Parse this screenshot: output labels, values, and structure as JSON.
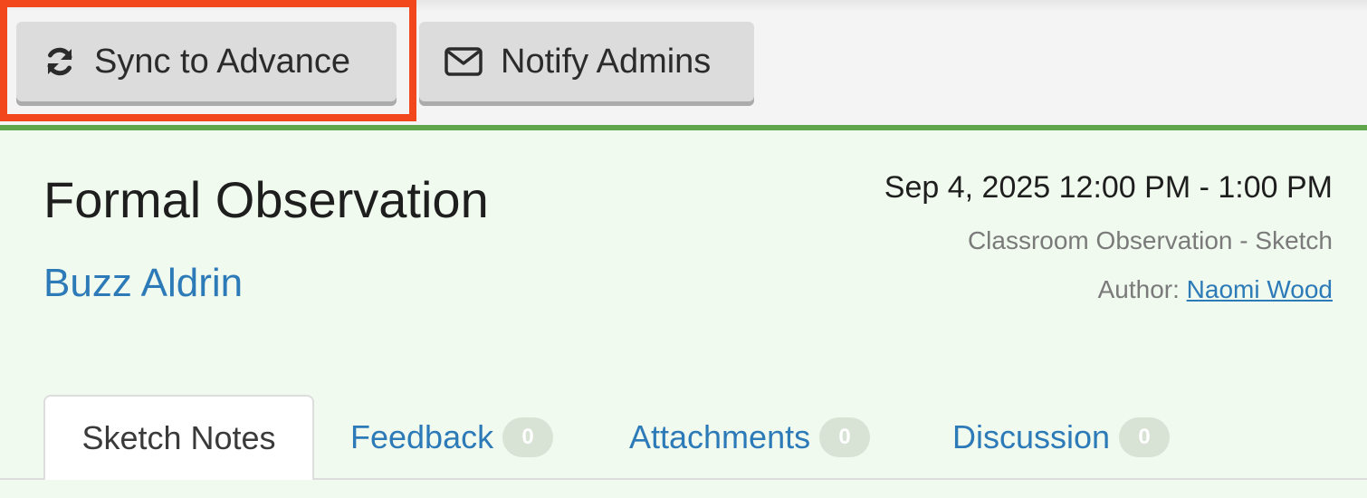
{
  "toolbar": {
    "sync_label": "Sync to Advance",
    "sync_icon": "refresh-icon",
    "notify_label": "Notify Admins",
    "notify_icon": "envelope-icon",
    "highlight_color": "#f2471c"
  },
  "observation": {
    "title": "Formal Observation",
    "person": "Buzz Aldrin",
    "datetime": "Sep 4, 2025 12:00 PM - 1:00 PM",
    "type": "Classroom Observation - Sketch",
    "author_label": "Author:",
    "author_name": "Naomi Wood"
  },
  "tabs": [
    {
      "label": "Sketch Notes",
      "active": true
    },
    {
      "label": "Feedback",
      "count": "0"
    },
    {
      "label": "Attachments",
      "count": "0"
    },
    {
      "label": "Discussion",
      "count": "0"
    }
  ],
  "colors": {
    "accent_green": "#5fa54b",
    "panel_bg": "#f0faee",
    "link_blue": "#2d7ab8"
  }
}
